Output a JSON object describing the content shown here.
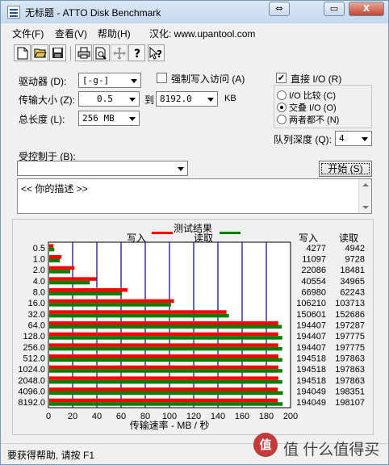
{
  "window": {
    "title": "无标题 - ATTO Disk Benchmark",
    "min": "⇔",
    "max": "▭",
    "close": "X"
  },
  "menu": {
    "file": "文件(F)",
    "view": "查看(V)",
    "help": "帮助(H)",
    "localization": "汉化: www.upantool.com"
  },
  "toolbar": {
    "icons": [
      "new-icon",
      "open-icon",
      "save-icon",
      "print-icon",
      "print-preview-icon",
      "move-icon",
      "help-icon",
      "context-help-icon"
    ]
  },
  "form": {
    "drive_label": "驱动器 (D):",
    "drive_value": "[-g-]",
    "force_write_label": "强制写入访问 (A)",
    "force_write_checked": false,
    "transfer_label": "传输大小 (Z):",
    "transfer_from": "0.5",
    "to_label": "到",
    "transfer_to": "8192.0",
    "kb_unit": "KB",
    "total_label": "总长度 (L):",
    "total_value": "256 MB",
    "direct_io_label": "直接 I/O (R)",
    "direct_io_checked": true,
    "compare_io_label": "I/O 比较 (C)",
    "overlap_io_label": "交叠 I/O (O)",
    "neither_label": "两者都不 (N)",
    "selected_mode": "overlap",
    "queue_label": "队列深度 (Q):",
    "queue_value": "4",
    "controlled_label": "受控制于 (B):",
    "controlled_value": "",
    "start_button": "开始 (S)",
    "description": "<<  你的描述  >>"
  },
  "chart_data": {
    "type": "bar",
    "title": "测试结果",
    "legend_write": "写入",
    "legend_read": "读取",
    "xlabel": "传输速率 - MB / 秒",
    "xlim": [
      0,
      200
    ],
    "x_ticks": [
      "0",
      "20",
      "40",
      "60",
      "80",
      "100",
      "120",
      "140",
      "160",
      "180",
      "200"
    ],
    "col_write": "写入",
    "col_read": "读取",
    "colors": {
      "write": "#ff0000",
      "read": "#008000",
      "grid": "#0000a0",
      "bg": "#ffffff"
    },
    "categories": [
      "0.5",
      "1.0",
      "2.0",
      "4.0",
      "8.0",
      "16.0",
      "32.0",
      "64.0",
      "128.0",
      "256.0",
      "512.0",
      "1024.0",
      "2048.0",
      "4096.0",
      "8192.0"
    ],
    "series": [
      {
        "name": "写入",
        "unit": "KB/s",
        "values": [
          4277,
          11097,
          22086,
          40554,
          66980,
          106210,
          150601,
          194407,
          194407,
          194407,
          194518,
          194518,
          194518,
          194049,
          194049
        ]
      },
      {
        "name": "读取",
        "unit": "KB/s",
        "values": [
          4942,
          9728,
          18481,
          34965,
          62243,
          103713,
          152686,
          197287,
          197775,
          197775,
          197863,
          197863,
          197863,
          198351,
          198107
        ]
      }
    ]
  },
  "status": {
    "text": "要获得帮助, 请按 F1"
  },
  "watermark": {
    "text": "值 什么值得买"
  }
}
